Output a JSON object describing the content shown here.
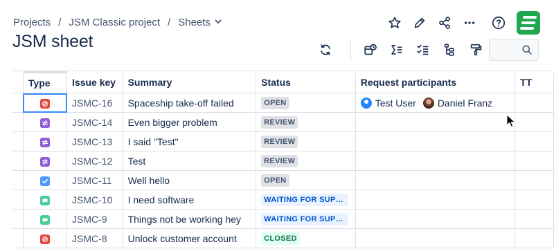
{
  "breadcrumb": {
    "items": [
      "Projects",
      "JSM Classic project",
      "Sheets"
    ]
  },
  "page": {
    "title": "JSM sheet"
  },
  "top_actions": [
    "star-icon",
    "pencil-icon",
    "share-icon",
    "more-icon",
    "help-icon",
    "app-logo"
  ],
  "toolbar": {
    "icons": [
      "refresh-icon",
      "ticket-status-icon",
      "sum-icon",
      "checklist-icon",
      "hierarchy-icon",
      "paint-roller-icon"
    ],
    "search_icon": "search-icon"
  },
  "table": {
    "columns": [
      "Type",
      "Issue key",
      "Summary",
      "Status",
      "Request participants",
      "TT"
    ],
    "rows": [
      {
        "type": "incident",
        "key": "JSMC-16",
        "summary": "Spaceship take-off failed",
        "status": "OPEN",
        "participants": [
          "Test User",
          "Daniel Franz"
        ]
      },
      {
        "type": "change",
        "key": "JSMC-14",
        "summary": "Even bigger problem",
        "status": "REVIEW",
        "participants": []
      },
      {
        "type": "change",
        "key": "JSMC-13",
        "summary": "I said \"Test\"",
        "status": "REVIEW",
        "participants": []
      },
      {
        "type": "change",
        "key": "JSMC-12",
        "summary": "Test",
        "status": "REVIEW",
        "participants": []
      },
      {
        "type": "task",
        "key": "JSMC-11",
        "summary": "Well hello",
        "status": "OPEN",
        "participants": []
      },
      {
        "type": "service-request",
        "key": "JSMC-10",
        "summary": "I need software",
        "status": "WAITING FOR SUPPORT",
        "participants": []
      },
      {
        "type": "service-request",
        "key": "JSMC-9",
        "summary": "Things not be working hey",
        "status": "WAITING FOR SUPPORT",
        "participants": []
      },
      {
        "type": "incident",
        "key": "JSMC-8",
        "summary": "Unlock customer account",
        "status": "CLOSED",
        "participants": []
      }
    ]
  },
  "colors": {
    "incident": "#e2483d",
    "change": "#8f5dd7",
    "task": "#4c9aff",
    "service-request": "#4bce97",
    "status_open_bg": "#dfe1e6",
    "status_open_fg": "#44546f",
    "status_waiting_bg": "#e9f2ff",
    "status_waiting_fg": "#0055cc",
    "status_closed_bg": "#dcfff1",
    "status_closed_fg": "#216e4e",
    "selection": "#388bff",
    "brand": "#1fa84f"
  }
}
